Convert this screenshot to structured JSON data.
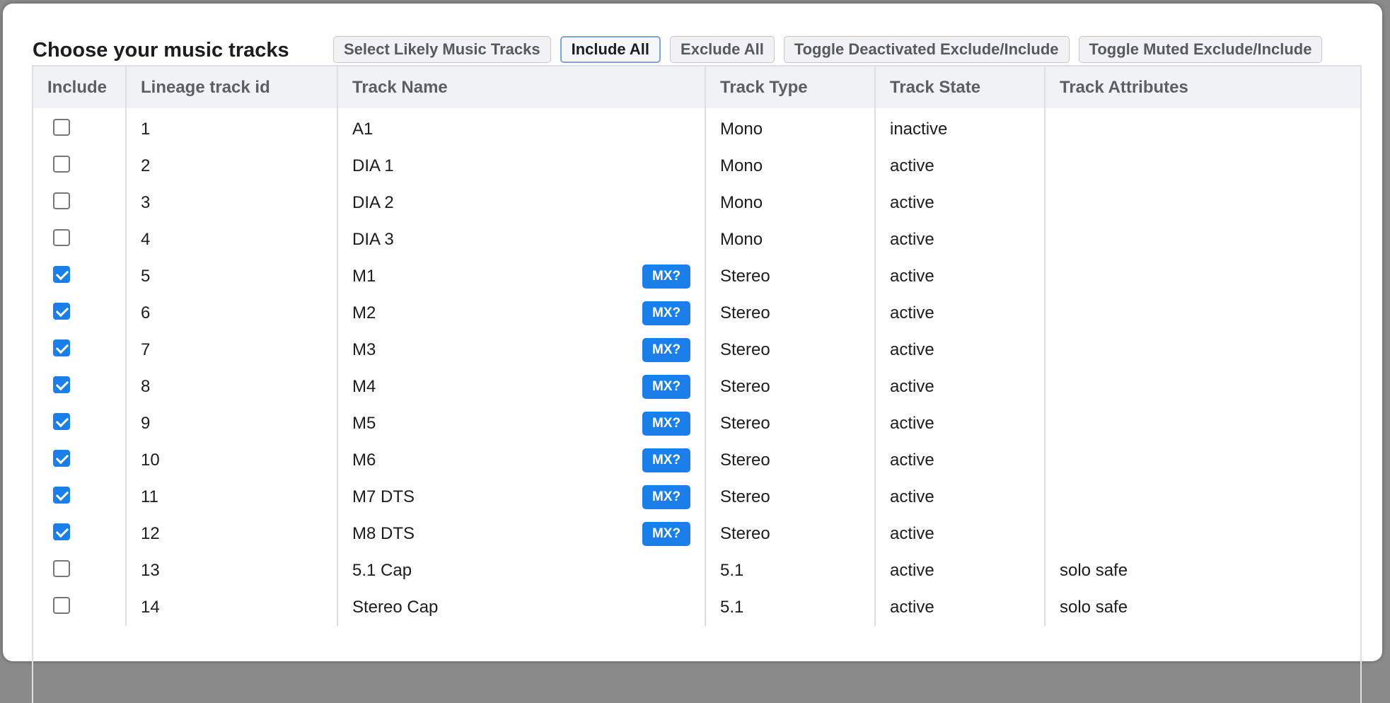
{
  "title": "Choose your music tracks",
  "toolbar": {
    "select_likely": "Select Likely Music Tracks",
    "include_all": "Include All",
    "exclude_all": "Exclude All",
    "toggle_deactivated": "Toggle Deactivated Exclude/Include",
    "toggle_muted": "Toggle Muted Exclude/Include"
  },
  "columns": [
    "Include",
    "Lineage track id",
    "Track Name",
    "Track Type",
    "Track State",
    "Track Attributes"
  ],
  "badge_label": "MX?",
  "colors": {
    "accent": "#1a7fe8",
    "header_bg": "#f1f2f5"
  },
  "rows": [
    {
      "included": false,
      "id": "1",
      "name": "A1",
      "mx": false,
      "type": "Mono",
      "state": "inactive",
      "attributes": ""
    },
    {
      "included": false,
      "id": "2",
      "name": "DIA 1",
      "mx": false,
      "type": "Mono",
      "state": "active",
      "attributes": ""
    },
    {
      "included": false,
      "id": "3",
      "name": "DIA 2",
      "mx": false,
      "type": "Mono",
      "state": "active",
      "attributes": ""
    },
    {
      "included": false,
      "id": "4",
      "name": "DIA 3",
      "mx": false,
      "type": "Mono",
      "state": "active",
      "attributes": ""
    },
    {
      "included": true,
      "id": "5",
      "name": "M1",
      "mx": true,
      "type": "Stereo",
      "state": "active",
      "attributes": ""
    },
    {
      "included": true,
      "id": "6",
      "name": "M2",
      "mx": true,
      "type": "Stereo",
      "state": "active",
      "attributes": ""
    },
    {
      "included": true,
      "id": "7",
      "name": "M3",
      "mx": true,
      "type": "Stereo",
      "state": "active",
      "attributes": ""
    },
    {
      "included": true,
      "id": "8",
      "name": "M4",
      "mx": true,
      "type": "Stereo",
      "state": "active",
      "attributes": ""
    },
    {
      "included": true,
      "id": "9",
      "name": "M5",
      "mx": true,
      "type": "Stereo",
      "state": "active",
      "attributes": ""
    },
    {
      "included": true,
      "id": "10",
      "name": "M6",
      "mx": true,
      "type": "Stereo",
      "state": "active",
      "attributes": ""
    },
    {
      "included": true,
      "id": "11",
      "name": "M7 DTS",
      "mx": true,
      "type": "Stereo",
      "state": "active",
      "attributes": ""
    },
    {
      "included": true,
      "id": "12",
      "name": "M8 DTS",
      "mx": true,
      "type": "Stereo",
      "state": "active",
      "attributes": ""
    },
    {
      "included": false,
      "id": "13",
      "name": "5.1 Cap",
      "mx": false,
      "type": "5.1",
      "state": "active",
      "attributes": "solo safe"
    },
    {
      "included": false,
      "id": "14",
      "name": "Stereo Cap",
      "mx": false,
      "type": "5.1",
      "state": "active",
      "attributes": "solo safe"
    }
  ]
}
